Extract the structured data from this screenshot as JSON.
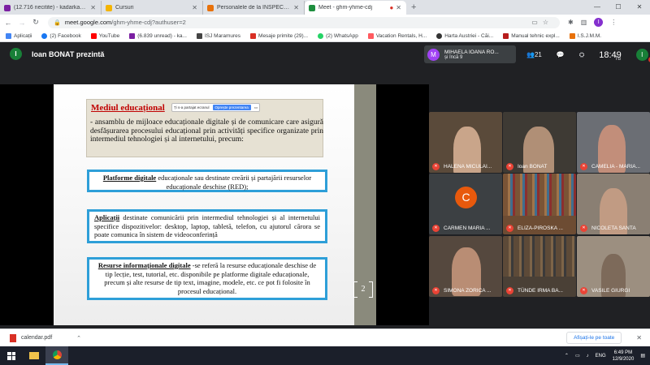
{
  "browser": {
    "tabs": [
      {
        "title": "(12.716 necitite) - kadarkadar@y",
        "color": "#7b1fa2",
        "active": false
      },
      {
        "title": "Cursuri",
        "color": "#f4b400",
        "active": false
      },
      {
        "title": "Personalele de la INSPECTIE_SCOL",
        "color": "#e8710a",
        "active": false
      },
      {
        "title": "Meet - ghm-yhme-cdj",
        "color": "#1e8e3e",
        "active": true
      }
    ],
    "new_tab": "+",
    "address": {
      "host": "meet.google.com",
      "path": "/ghm-yhme-cdj?authuser=2"
    },
    "profile_initial": "I",
    "bookmarks": [
      {
        "label": "Aplicații",
        "color": "#5f6368"
      },
      {
        "label": "(2) Facebook",
        "color": "#1877f2"
      },
      {
        "label": "YouTube",
        "color": "#ff0000"
      },
      {
        "label": "(6.839 unread) - ka...",
        "color": "#7b1fa2"
      },
      {
        "label": "ISJ Maramures",
        "color": "#444"
      },
      {
        "label": "Mesaje primite (29)...",
        "color": "#d93025"
      },
      {
        "label": "(2) WhatsApp",
        "color": "#25d366"
      },
      {
        "label": "Vacation Rentals, H...",
        "color": "#ff5a5f"
      },
      {
        "label": "Harta Austriei - Căi...",
        "color": "#333"
      },
      {
        "label": "Manual tehnic expl...",
        "color": "#b71c1c"
      },
      {
        "label": "I.S.J.M.M.",
        "color": "#e8710a"
      }
    ]
  },
  "meet": {
    "presenter_initial": "I",
    "presenter_label": "Ioan BONAT prezintă",
    "pinned": {
      "initial": "M",
      "name": "MIHAELA IOANA RO...",
      "sub": "și încă 9"
    },
    "participant_count": "21",
    "clock": "18:49",
    "self_initial": "I",
    "self_badge": "6",
    "self_label": "Tu",
    "tiles": [
      {
        "name": "HALENA MICULAI...",
        "bg": "#5a4a3a"
      },
      {
        "name": "Ioan BONAT",
        "bg": "#3e3a34"
      },
      {
        "name": "CAMELIA - MARIA...",
        "bg": "#6b6e74"
      },
      {
        "name": "CARMEN MARIA ...",
        "bg": "#3c4043",
        "initial": "C"
      },
      {
        "name": "ELIZA-PIROSKA ...",
        "bg": "#6d4c33"
      },
      {
        "name": "NICOLETA SANTA",
        "bg": "#8a7f73"
      },
      {
        "name": "SIMONA ZORICA ...",
        "bg": "#55483e"
      },
      {
        "name": "TÜNDE IRMA BA...",
        "bg": "#4a4036"
      },
      {
        "name": "VASILE GIURGI",
        "bg": "#9c8f80"
      }
    ]
  },
  "slide": {
    "title": "Mediul educațional",
    "translate_text": "Ți s-a partajat ecranul",
    "translate_button": "Oprește prezentarea",
    "intro": "- ansamblu de mijloace educaționale digitale și de comunicare care asigură desfășurarea procesului educațional prin activități specifice organizate prin intermediul tehnologiei și al internetului, precum:",
    "box1_head": "Platforme digitale",
    "box1_text": " educaționale sau destinate creării și partajării resurselor educaționale deschise (RED);",
    "box2_head": "Aplicații",
    "box2_text": " destinate comunicării prin intermediul tehnologiei și al internetului specifice dispozitivelor: desktop, laptop, tabletă, telefon, cu ajutorul cărora se poate comunica în sistem de videoconferință",
    "box3_head": "Resurse informaționale digitale",
    "box3_text": " -se referă la resurse educaționale deschise de tip lecție, test, tutorial, etc. disponibile pe platforme digitale educaționale, precum și alte resurse de tip text, imagine, modele, etc. ce pot fi folosite în procesul educațional.",
    "page_number": "2"
  },
  "downloads": {
    "file": "calendar.pdf",
    "show_all": "Afișați-le pe toate"
  },
  "taskbar": {
    "lang": "ENG",
    "time": "6:49 PM",
    "date": "12/9/2020"
  }
}
